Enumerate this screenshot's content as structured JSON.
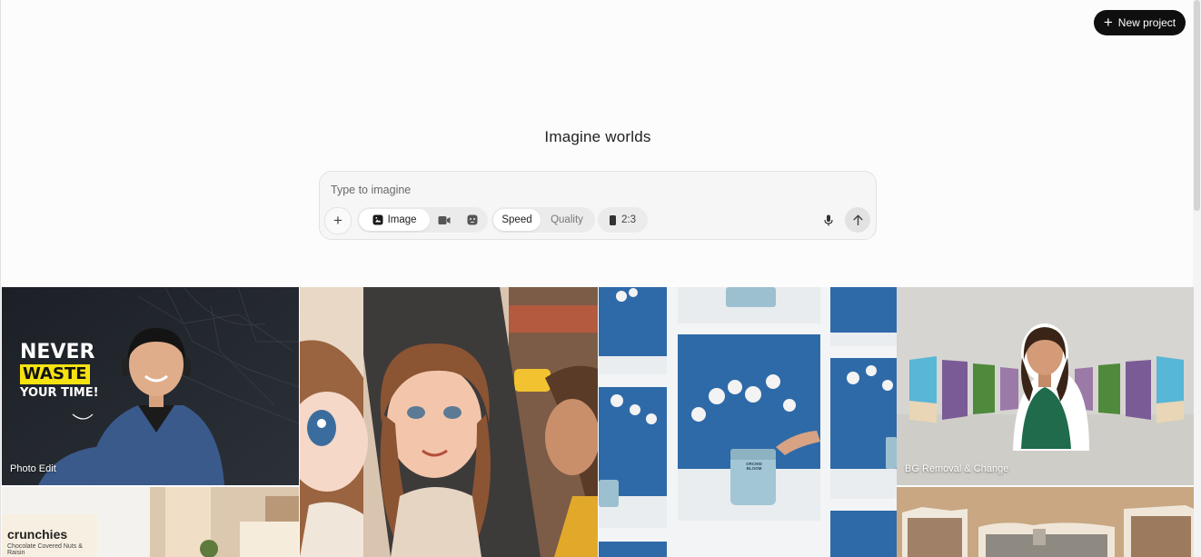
{
  "header": {
    "new_project_label": "New project"
  },
  "hero": {
    "title": "Imagine worlds"
  },
  "prompt": {
    "placeholder": "Type to imagine",
    "modes": [
      {
        "label": "Image",
        "icon": "image-icon",
        "active": true
      },
      {
        "label": "",
        "icon": "video-icon",
        "active": false
      },
      {
        "label": "",
        "icon": "character-icon",
        "active": false
      }
    ],
    "quality_modes": [
      {
        "label": "Speed",
        "active": true
      },
      {
        "label": "Quality",
        "active": false
      }
    ],
    "aspect_ratio": "2:3"
  },
  "gallery": {
    "photo_edit": {
      "label": "Photo Edit",
      "overlay_lines": [
        "NEVER",
        "WASTE",
        "YOUR TIME!"
      ]
    },
    "bg_removal": {
      "label": "BG Removal & Change"
    },
    "product": {
      "brand": "crunchies",
      "subtitle": "Chocolate Covered Nuts & Raisin",
      "jar_lines": [
        "ORCHID",
        "BLOOM"
      ]
    }
  },
  "colors": {
    "accent": "#0f0f0f",
    "background": "#fcfcfc",
    "panel": "#f6f6f6"
  }
}
